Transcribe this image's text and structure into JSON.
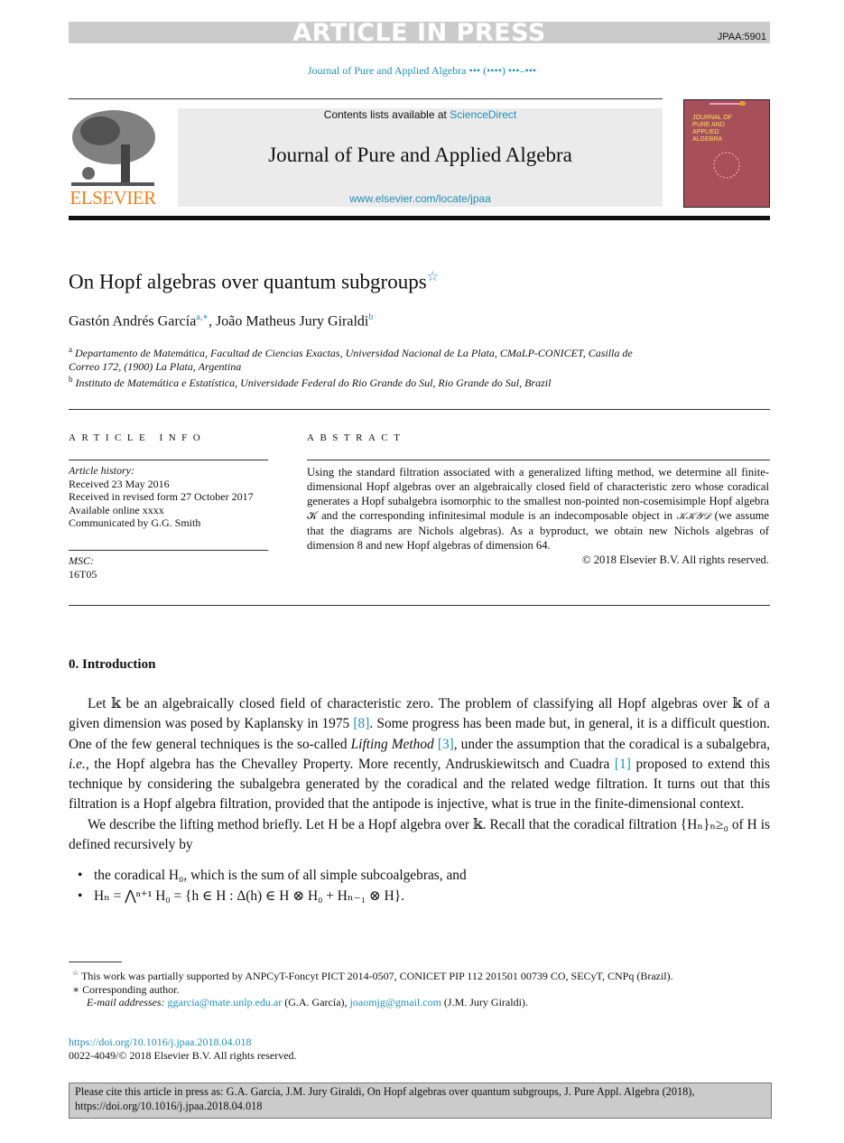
{
  "banner": {
    "article_in_press": "ARTICLE IN PRESS",
    "article_id": "JPAA:5901"
  },
  "journal_ref": "Journal of Pure and Applied Algebra ••• (••••) •••–•••",
  "header": {
    "publisher_logo": "ELSEVIER",
    "contents_prefix": "Contents lists available at ",
    "sciencedirect": "ScienceDirect",
    "journal_title": "Journal of Pure and Applied Algebra",
    "journal_url": "www.elsevier.com/locate/jpaa",
    "cover_title": "JOURNAL OF PURE AND APPLIED ALGEBRA",
    "cover_color": "#a8505a"
  },
  "article": {
    "title": "On Hopf algebras over quantum subgroups",
    "title_mark": "☆",
    "authors": [
      {
        "name": "Gastón Andrés García",
        "marks": "a,∗"
      },
      {
        "name": "João Matheus Jury Giraldi",
        "marks": "b"
      }
    ],
    "affiliations": [
      {
        "mark": "a",
        "text": "Departamento de Matemática, Facultad de Ciencias Exactas, Universidad Nacional de La Plata, CMaLP-CONICET, Casilla de Correo 172, (1900) La Plata, Argentina"
      },
      {
        "mark": "b",
        "text": "Instituto de Matemática e Estatística, Universidade Federal do Rio Grande do Sul, Rio Grande do Sul, Brazil"
      }
    ]
  },
  "article_info": {
    "heading": "ARTICLE INFO",
    "history_label": "Article history:",
    "history": [
      "Received 23 May 2016",
      "Received in revised form 27 October 2017",
      "Available online xxxx",
      "Communicated by G.G. Smith"
    ],
    "msc_label": "MSC:",
    "msc": "16T05"
  },
  "abstract": {
    "heading": "ABSTRACT",
    "text": "Using the standard filtration associated with a generalized lifting method, we determine all finite-dimensional Hopf algebras over an algebraically closed field of characteristic zero whose coradical generates a Hopf subalgebra isomorphic to the smallest non-pointed non-cosemisimple Hopf algebra 𝒦 and the corresponding infinitesimal module is an indecomposable object in ",
    "math": "𝒦𝒦𝒴𝒟",
    "text2": " (we assume that the diagrams are Nichols algebras). As a byproduct, we obtain new Nichols algebras of dimension 8 and new Hopf algebras of dimension 64.",
    "copyright": "© 2018 Elsevier B.V. All rights reserved."
  },
  "intro": {
    "heading": "0. Introduction",
    "p1": [
      "Let 𝕜 be an algebraically closed field of characteristic zero. The problem of classifying all Hopf algebras over 𝕜 of a given dimension was posed by Kaplansky in 1975 ",
      "[8]",
      ". Some progress has been made but, in general, it is a difficult question. One of the few general techniques is the so-called ",
      "Lifting Method",
      " ",
      "[3]",
      ", under the assumption that the coradical is a subalgebra, ",
      "i.e.",
      ", the Hopf algebra has the Chevalley Property. More recently, Andruskiewitsch and Cuadra ",
      "[1]",
      " proposed to extend this technique by considering the subalgebra generated by the coradical and the related wedge filtration. It turns out that this filtration is a Hopf algebra filtration, provided that the antipode is injective, what is true in the finite-dimensional context."
    ],
    "p2": "We describe the lifting method briefly. Let H be a Hopf algebra over 𝕜. Recall that the coradical filtration {Hₙ}ₙ≥₀ of H is defined recursively by",
    "bullets": [
      "the coradical H₀, which is the sum of all simple subcoalgebras, and",
      "Hₙ = ⋀ⁿ⁺¹ H₀ = {h ∈ H :  Δ(h) ∈ H ⊗ H₀ + Hₙ₋₁ ⊗ H}."
    ]
  },
  "footnotes": {
    "funding_mark": "☆",
    "funding": "This work was partially supported by ANPCyT-Foncyt PICT 2014-0507, CONICET PIP 112 201501 00739 CO, SECyT, CNPq (Brazil).",
    "corr_mark": "∗",
    "corr": "Corresponding author.",
    "email_label": "E-mail addresses:",
    "email1": "ggarcia@mate.unlp.edu.ar",
    "email1_owner": " (G.A. García), ",
    "email2": "joaomjg@gmail.com",
    "email2_owner": " (J.M. Jury Giraldi)."
  },
  "doi": "https://doi.org/10.1016/j.jpaa.2018.04.018",
  "issn": "0022-4049/© 2018 Elsevier B.V. All rights reserved.",
  "citation": "Please cite this article in press as: G.A. García, J.M. Jury Giraldi, On Hopf algebras over quantum subgroups, J. Pure Appl. Algebra (2018), https://doi.org/10.1016/j.jpaa.2018.04.018",
  "colors": {
    "link": "#1f8fb8",
    "publisher": "#f07f1a",
    "banner_gray": "#cbcbcb"
  }
}
